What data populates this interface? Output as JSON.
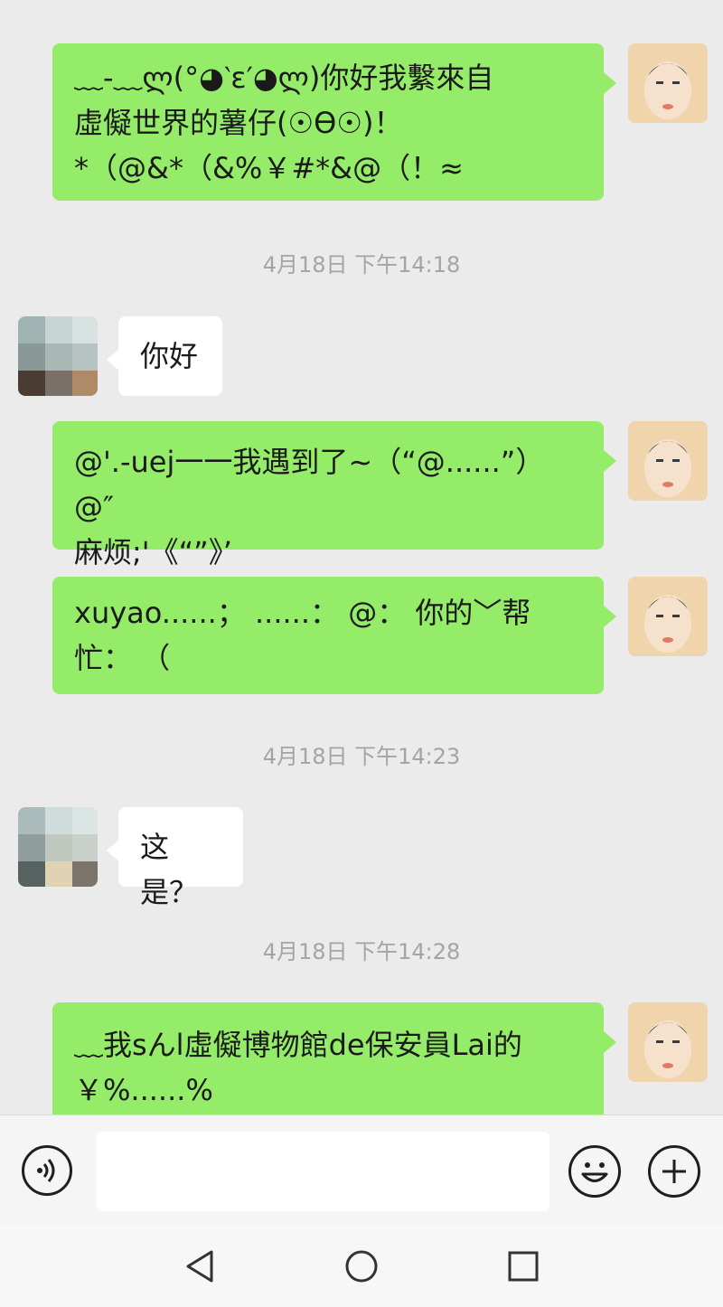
{
  "messages": [
    {
      "side": "me",
      "text": "﹏-﹏ლ(°◕‵ε′◕ლ)你好我繫來自\n虛儗世界的薯仔(☉ϴ☉)！\n*（@&*（&%￥#*&@（！≈"
    },
    {
      "side": "time",
      "text": "4月18日 下午14:18"
    },
    {
      "side": "other",
      "text": "你好"
    },
    {
      "side": "me",
      "text": "@'.-uej一一我遇到了~（“@......”）@″\n麻烦;'《“”》’"
    },
    {
      "side": "me",
      "text": "xuyao......； ......： @： 你的﹀帮\n忙： （"
    },
    {
      "side": "time",
      "text": "4月18日 下午14:23"
    },
    {
      "side": "other",
      "text": "这是？"
    },
    {
      "side": "time",
      "text": "4月18日 下午14:28"
    },
    {
      "side": "me",
      "text": "﹏我sんl虛儗博物館de保安員Lai的\n￥%......%"
    }
  ],
  "icons": {
    "voice": "voice-icon",
    "emoji": "emoji-icon",
    "more": "plus-icon",
    "back": "nav-back-icon",
    "home": "nav-home-icon",
    "recents": "nav-recents-icon"
  },
  "colors": {
    "my_bubble": "#95ec69",
    "other_bubble": "#ffffff",
    "chat_bg": "#ebebeb",
    "timestamp": "#a4a4a4"
  },
  "input": {
    "value": "",
    "placeholder": ""
  }
}
